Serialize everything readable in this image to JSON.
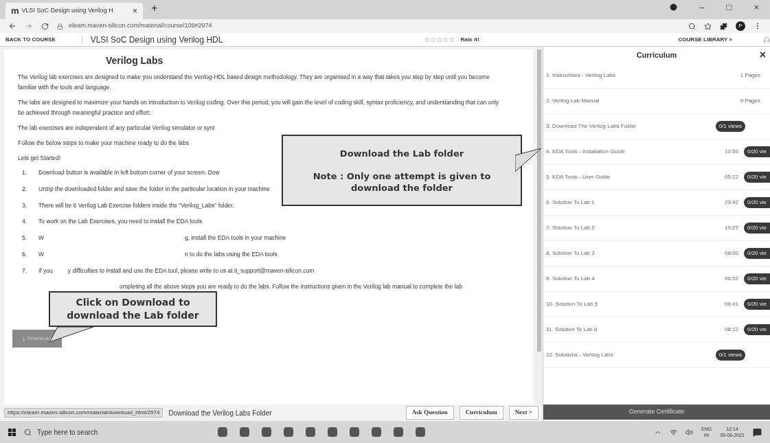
{
  "browser": {
    "tab_title": "VLSI SoC Design using Verilog H",
    "tab_close": "×",
    "new_tab": "+",
    "url": "elearn.maven-silicon.com/material/course/109#2974",
    "window_buttons": [
      "–",
      "□",
      "×"
    ],
    "profile": "P",
    "logo": "m"
  },
  "header": {
    "back": "BACK TO COURSE",
    "course_title": "VLSI SoC Design using Verilog HDL",
    "stars": 0,
    "rate": "Rate it!",
    "library": "COURSE LIBRARY >"
  },
  "content": {
    "title": "Verilog Labs",
    "paragraphs": [
      "The Verilog lab exercises are designed to make you understand the Verilog-HDL based design methodology. They are organised in a way that takes you step by step until you become familiar with the tools and language.",
      "The labs are designed to maximize your hands on introduction to Verilog coding. Over this period, you will gain the level of coding skill, syntax proficiency, and understanding that can only be achieved through meaningful practice and effort.",
      "The lab exercises are independent of any particular Verilog simulator or synt",
      "Follow the below steps to make your machine ready to do the labs",
      "Lets get Started!"
    ],
    "steps": [
      {
        "number": "1.",
        "before": "Download button is available in left bottom corner  of your screen. Dow"
      },
      {
        "number": "2.",
        "before": "Unzip the downloaded folder and save the folder in the particular location in your machine"
      },
      {
        "number": "3.",
        "before": "There will be 6 Verilog Lab Exercise folders inside the \"Verilog_Labs\" folder."
      },
      {
        "number": "4.",
        "before": "To work on the Lab Exercises, you need to install the EDA tools"
      },
      {
        "number": "5.",
        "before": "W",
        "after": "g, install the EDA tools in your machine"
      },
      {
        "number": "6.",
        "before": "W",
        "after": "n to do the labs using the EDA tools"
      },
      {
        "number": "7.",
        "before": "If you",
        "after": "y difficulties to install and use the EDA tool, please write to us at it_support@maven-silicon.com"
      },
      {
        "before": "ompleting all the above steps  you are ready to do the labs. Follow the instructions given in the Verilog lab manual to complete the lab"
      }
    ],
    "download_button": "⤓ Download",
    "callout_top": {
      "title": "Download the Lab folder",
      "note": "Note : Only one attempt is given to download the folder"
    },
    "callout_left": "Click on Download to download the Lab folder",
    "status_url": "https://elearn.maven-silicon.com/material/download_html/2974",
    "bottom_text": "Download the Verilog Labs Folder",
    "nav_buttons": [
      "Ask Question",
      "Curriculum",
      "Next >"
    ]
  },
  "curriculum": {
    "title": "Curriculum",
    "close": "×",
    "items": [
      {
        "title": "1. Instructions - Verilog Labs",
        "info": "1 Pages"
      },
      {
        "title": "2. Verilog Lab Manual",
        "info": "9 Pages"
      },
      {
        "title": "3. Download The Verilog Labs Folder",
        "badge": "0/1 views"
      },
      {
        "title": "4. EDA Tools - Installation Guide",
        "info": "10:50",
        "badge": "0/20 vie"
      },
      {
        "title": "5. EDA Tools - User Guide",
        "info": "05:22",
        "badge": "0/20 vie"
      },
      {
        "title": "6. Solution To Lab 1",
        "info": "23:42",
        "badge": "0/20 vie"
      },
      {
        "title": "7. Solution To Lab 2",
        "info": "10:27",
        "badge": "0/20 vie"
      },
      {
        "title": "8. Solution To Lab 3",
        "info": "08:00",
        "badge": "0/20 vie"
      },
      {
        "title": "9. Solution To Lab 4",
        "info": "06:52",
        "badge": "0/20 vie"
      },
      {
        "title": "10. Solution To Lab 5",
        "info": "06:41",
        "badge": "0/20 vie"
      },
      {
        "title": "11. Solution To Lab 6",
        "info": "08:12",
        "badge": "0/20 vie"
      },
      {
        "title": "12. Solutions - Verilog Labs",
        "badge": "0/1 views"
      }
    ],
    "certificate": "Generate Certificate"
  },
  "taskbar": {
    "search_placeholder": "Type here to search",
    "language": "ENG",
    "region": "IN",
    "time": "12:14",
    "date": "09-06-2021"
  }
}
